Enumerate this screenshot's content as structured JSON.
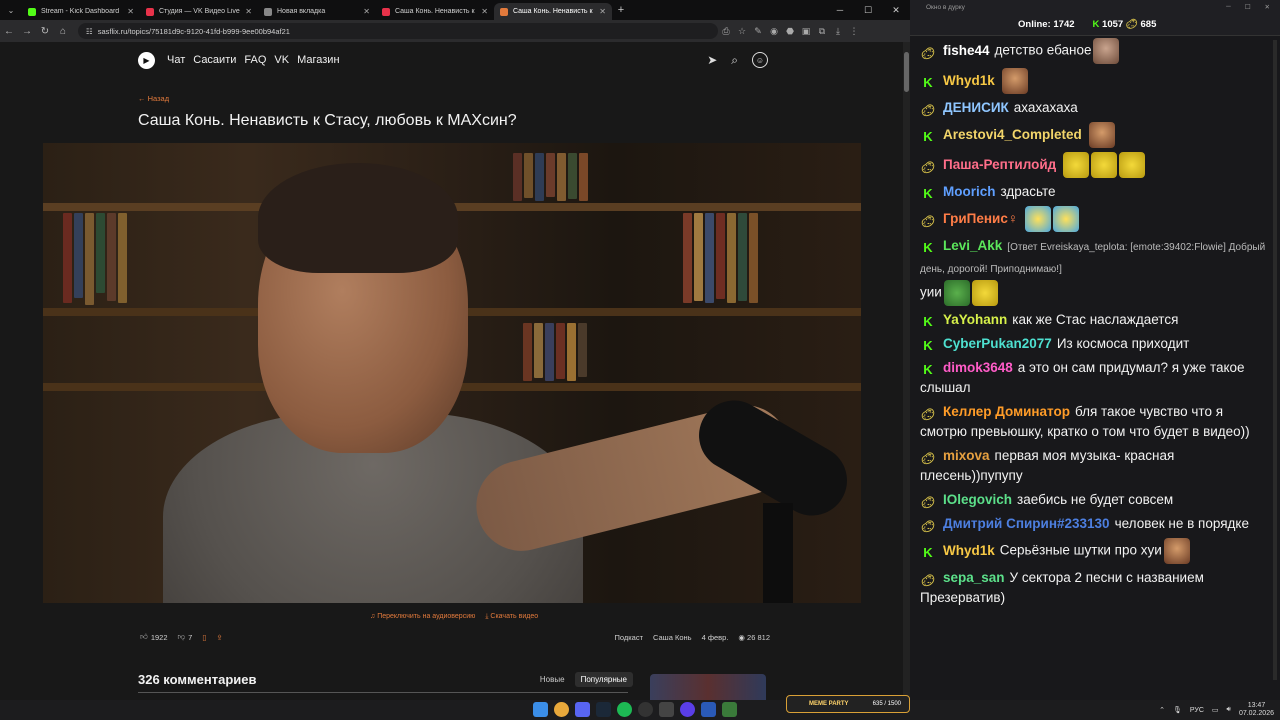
{
  "browser": {
    "tabs": [
      {
        "title": "Stream - Kick Dashboard",
        "color": "#53fc18"
      },
      {
        "title": "Студия — VK Видео Live",
        "color": "#e8324a"
      },
      {
        "title": "Новая вкладка",
        "color": "#888888"
      },
      {
        "title": "Саша Конь. Ненависть к Стас...",
        "color": "#e8324a"
      },
      {
        "title": "Саша Конь. Ненависть к С...",
        "color": "#e27a3c"
      }
    ],
    "url": "sasflix.ru/topics/75181d9c-9120-41fd-b999-9ee00b94af21"
  },
  "site": {
    "nav": [
      "Чат",
      "Сасаити",
      "FAQ",
      "VK",
      "Магазин"
    ],
    "back_label": "← Назад",
    "title": "Саша Конь. Ненависть к Стасу, любовь к МАХсин?",
    "audio_link": "Переключить на аудиоверсию",
    "download_link": "Скачать видео",
    "likes": "1922",
    "dislikes": "7",
    "tag_podcast": "Подкаст",
    "tag_guest": "Саша Конь",
    "date": "4 февр.",
    "views": "26 812",
    "comments_count": "326 комментариев",
    "sort_new": "Новые",
    "sort_popular": "Популярные"
  },
  "chat": {
    "window_title": "Окно в дурку",
    "online_label": "Online:",
    "online_value": "1742",
    "kick_value": "1057",
    "vk_value": "685",
    "messages": [
      {
        "platform": "vk",
        "name": "fishe44",
        "color": "#ffffff",
        "text": "детство ебаное",
        "emotes": [
          "face"
        ]
      },
      {
        "platform": "kick",
        "name": "Whyd1k",
        "color": "#f7c845",
        "text": "",
        "emotes": [
          "brown"
        ]
      },
      {
        "platform": "vk",
        "name": "ДЕНИСИК",
        "color": "#8fc6ff",
        "text": "ахахахаха",
        "emotes": []
      },
      {
        "platform": "kick",
        "name": "Arestovi4_Completed",
        "color": "#f2d56a",
        "text": "",
        "emotes": [
          "brown"
        ]
      },
      {
        "platform": "vk",
        "name": "Паша-Рептилойд",
        "color": "#ff6e8a",
        "text": "",
        "emotes": [
          "yellow",
          "yellow",
          "yellow"
        ]
      },
      {
        "platform": "kick",
        "name": "Moorich",
        "color": "#5f9fff",
        "text": "здрасьте",
        "emotes": []
      },
      {
        "platform": "vk",
        "name": "ГриПенис♀",
        "color": "#ff7d47",
        "text": "",
        "emotes": [
          "laugh",
          "laugh"
        ]
      },
      {
        "platform": "kick",
        "name": "Levi_Akk",
        "color": "#5be65b",
        "reply": "[Ответ Evreiskaya_teplota: [emote:39402:Flowie] Добрый день, дорогой! Приподнимаю!]",
        "text": "уии",
        "emotes": [
          "pepe",
          "yellow"
        ]
      },
      {
        "platform": "kick",
        "name": "YaYohann",
        "color": "#d6f04a",
        "text": "как же Стас наслаждается",
        "emotes": []
      },
      {
        "platform": "kick",
        "name": "CyberPukan2077",
        "color": "#4ee0d0",
        "text": "Из космоса приходит",
        "emotes": []
      },
      {
        "platform": "kick",
        "name": "dimok3648",
        "color": "#ff5cc8",
        "text": "а это он сам придумал? я уже такое слышал",
        "emotes": []
      },
      {
        "platform": "vk",
        "name": "Келлер Доминатор",
        "color": "#ff9c28",
        "text": "бля такое чувство что я смотрю превьюшку, кратко о том что будет в видео))",
        "emotes": []
      },
      {
        "platform": "vk",
        "name": "mixova",
        "color": "#e6a040",
        "text": "первая моя музыка- красная плесень))пупупу",
        "emotes": []
      },
      {
        "platform": "vk",
        "name": "IOlegovich",
        "color": "#5ce08a",
        "text": "заебись не будет совсем",
        "emotes": []
      },
      {
        "platform": "vk",
        "name": "Дмитрий Спирин#233130",
        "color": "#4d7fe0",
        "text": "человек не в порядке",
        "emotes": []
      },
      {
        "platform": "kick",
        "name": "Whyd1k",
        "color": "#f7c845",
        "text": "Серьёзные шутки про хуи",
        "emotes": [
          "brown"
        ]
      },
      {
        "platform": "vk",
        "name": "sepa_san",
        "color": "#5ce08a",
        "text": "У сектора 2 песни с названием Презерватив)",
        "emotes": []
      }
    ]
  },
  "taskbar": {
    "meme_label": "MEME PARTY",
    "meme_progress": "635 / 1500",
    "lang": "РУС",
    "time": "13:47",
    "date": "07.02.2026"
  },
  "colors": {
    "kick_green": "#53fc18",
    "accent_orange": "#e27a3c"
  }
}
